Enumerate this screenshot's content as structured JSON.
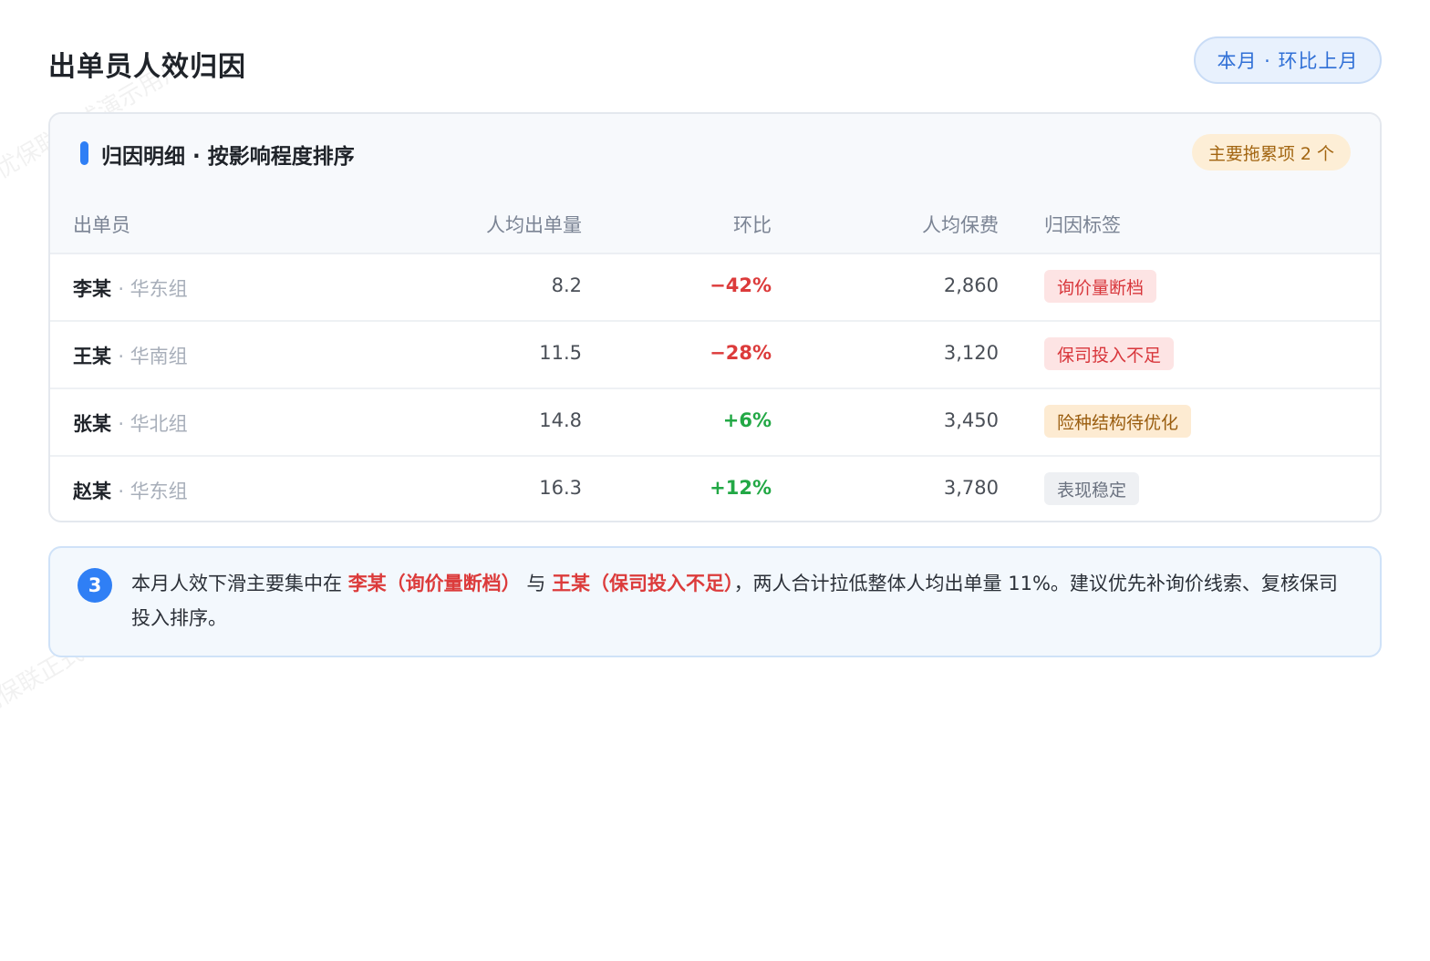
{
  "watermark": "优保联正式演示用户",
  "page": {
    "title": "出单员人效归因",
    "period": "本月 · 环比上月"
  },
  "card": {
    "title": "归因明细 · 按影响程度排序",
    "badge": "主要拖累项 2 个"
  },
  "columns": [
    "出单员",
    "人均出单量",
    "环比",
    "人均保费",
    "归因标签"
  ],
  "rows": [
    {
      "name": "李某",
      "group": "· 华东组",
      "qty": "8.2",
      "mom": "−42%",
      "mom_dir": "neg",
      "premium": "2,860",
      "tag": "询价量断档",
      "tag_tone": "red"
    },
    {
      "name": "王某",
      "group": "· 华南组",
      "qty": "11.5",
      "mom": "−28%",
      "mom_dir": "neg",
      "premium": "3,120",
      "tag": "保司投入不足",
      "tag_tone": "red"
    },
    {
      "name": "张某",
      "group": "· 华北组",
      "qty": "14.8",
      "mom": "+6%",
      "mom_dir": "pos",
      "premium": "3,450",
      "tag": "险种结构待优化",
      "tag_tone": "orange"
    },
    {
      "name": "赵某",
      "group": "· 华东组",
      "qty": "16.3",
      "mom": "+12%",
      "mom_dir": "pos",
      "premium": "3,780",
      "tag": "表现稳定",
      "tag_tone": "gray"
    }
  ],
  "insight": {
    "step": "3",
    "prefix": "本月人效下滑主要集中在",
    "hl1": "李某（询价量断档）",
    "join": "与",
    "hl2": "王某（保司投入不足）",
    "suffix": "，两人合计拉低整体人均出单量 11%。建议优先补询价线索、复核保司投入排序。"
  }
}
